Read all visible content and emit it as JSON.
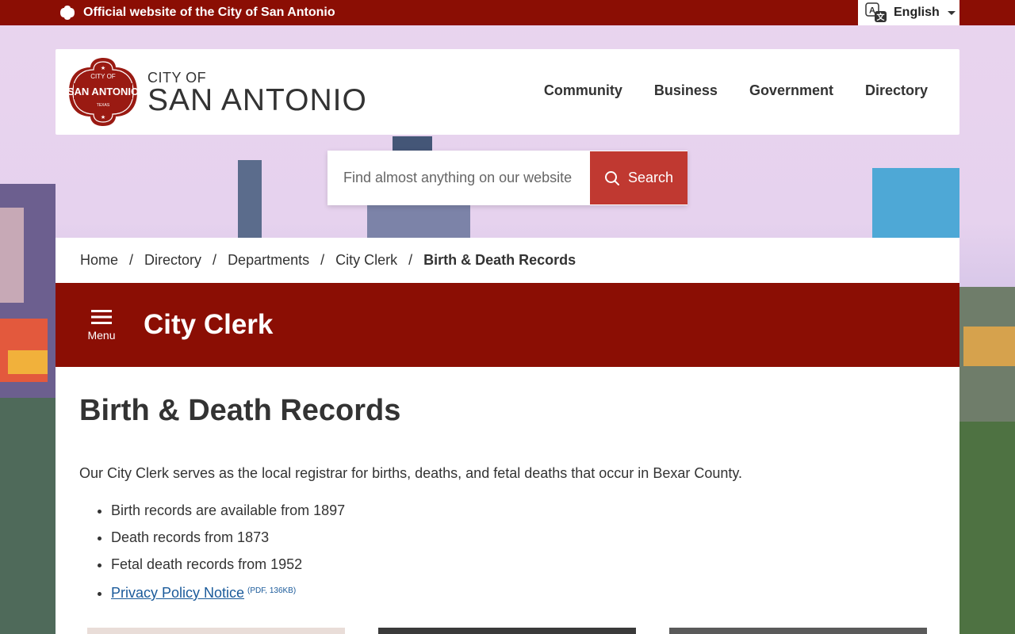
{
  "topbar": {
    "official_text": "Official website of the City of San Antonio",
    "language": "English"
  },
  "header": {
    "seal_text_top": "CITY OF",
    "seal_text_main": "SAN ANTONIO",
    "seal_text_bottom": "TEXAS",
    "logo_small": "CITY OF",
    "logo_big": "SAN ANTONIO",
    "nav": [
      "Community",
      "Business",
      "Government",
      "Directory"
    ]
  },
  "search": {
    "placeholder": "Find almost anything on our website",
    "button_label": "Search"
  },
  "breadcrumb": {
    "items": [
      "Home",
      "Directory",
      "Departments",
      "City Clerk"
    ],
    "current": "Birth & Death Records"
  },
  "department": {
    "menu_label": "Menu",
    "title": "City Clerk"
  },
  "content": {
    "heading": "Birth & Death Records",
    "intro": "Our City Clerk serves as the local registrar for births, deaths, and fetal deaths that occur in Bexar County.",
    "bullets": [
      "Birth records are available from 1897",
      "Death records from 1873",
      "Fetal death records from 1952"
    ],
    "privacy_link": "Privacy Policy Notice",
    "privacy_meta": "(PDF, 136KB)"
  },
  "colors": {
    "brand_red": "#8b0e04",
    "search_button": "#c03931",
    "link_blue": "#1a5a9a"
  }
}
